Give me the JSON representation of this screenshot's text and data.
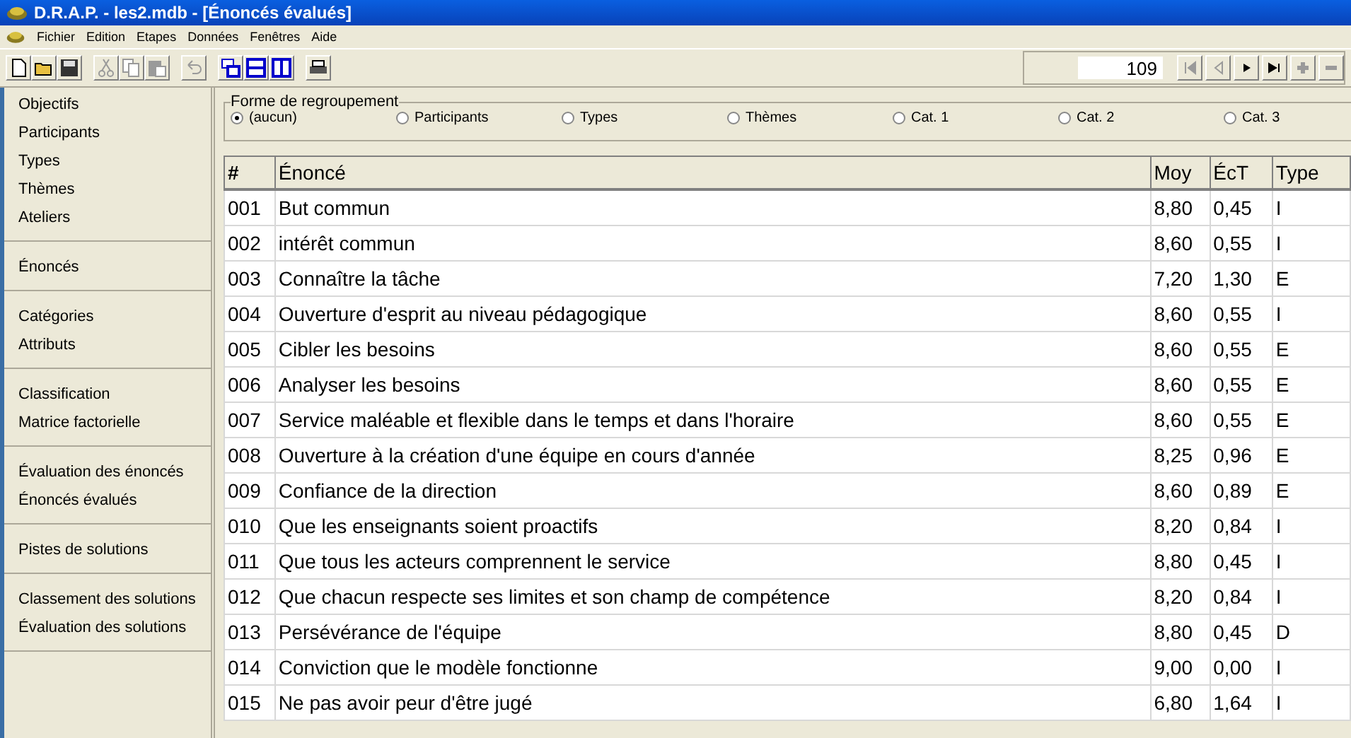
{
  "window": {
    "title": "D.R.A.P. - les2.mdb - [Énoncés évalués]"
  },
  "menu": [
    "Fichier",
    "Edition",
    "Etapes",
    "Données",
    "Fenêtres",
    "Aide"
  ],
  "toolbar": [
    {
      "kind": "new",
      "disabled": false
    },
    {
      "kind": "open",
      "disabled": false
    },
    {
      "kind": "save",
      "disabled": false
    },
    {
      "kind": "sep"
    },
    {
      "kind": "cut",
      "disabled": true
    },
    {
      "kind": "copy",
      "disabled": true
    },
    {
      "kind": "paste",
      "disabled": true
    },
    {
      "kind": "sep"
    },
    {
      "kind": "undo",
      "disabled": true
    },
    {
      "kind": "sep"
    },
    {
      "kind": "cascade",
      "disabled": false
    },
    {
      "kind": "tile-h",
      "disabled": false
    },
    {
      "kind": "tile-v",
      "disabled": false
    },
    {
      "kind": "sep"
    },
    {
      "kind": "print",
      "disabled": false
    }
  ],
  "navigator": {
    "record": "109",
    "buttons": [
      {
        "kind": "first",
        "disabled": true
      },
      {
        "kind": "prev",
        "disabled": true
      },
      {
        "kind": "next",
        "disabled": false
      },
      {
        "kind": "last",
        "disabled": false
      },
      {
        "kind": "add",
        "disabled": true
      },
      {
        "kind": "delete",
        "disabled": true
      }
    ]
  },
  "sidebar": [
    [
      "Objectifs",
      "Participants",
      "Types",
      "Thèmes",
      "Ateliers"
    ],
    [
      "Énoncés"
    ],
    [
      "Catégories",
      "Attributs"
    ],
    [
      "Classification",
      "Matrice factorielle"
    ],
    [
      "Évaluation des énoncés",
      "Énoncés évalués"
    ],
    [
      "Pistes de solutions"
    ],
    [
      "Classement des solutions",
      "Évaluation des solutions"
    ]
  ],
  "grouping": {
    "title": "Forme de regroupement",
    "options": [
      {
        "label": "(aucun)",
        "selected": true
      },
      {
        "label": "Participants",
        "selected": false
      },
      {
        "label": "Types",
        "selected": false
      },
      {
        "label": "Thèmes",
        "selected": false
      },
      {
        "label": "Cat. 1",
        "selected": false
      },
      {
        "label": "Cat. 2",
        "selected": false
      },
      {
        "label": "Cat. 3",
        "selected": false
      }
    ]
  },
  "table": {
    "columns": [
      "#",
      "Énoncé",
      "Moy",
      "ÉcT",
      "Type"
    ],
    "rows": [
      [
        "001",
        "But commun",
        "8,80",
        "0,45",
        "I"
      ],
      [
        "002",
        "intérêt commun",
        "8,60",
        "0,55",
        "I"
      ],
      [
        "003",
        "Connaître la tâche",
        "7,20",
        "1,30",
        "E"
      ],
      [
        "004",
        "Ouverture d'esprit au niveau pédagogique",
        "8,60",
        "0,55",
        "I"
      ],
      [
        "005",
        "Cibler les besoins",
        "8,60",
        "0,55",
        "E"
      ],
      [
        "006",
        "Analyser les besoins",
        "8,60",
        "0,55",
        "E"
      ],
      [
        "007",
        "Service maléable et flexible dans le temps et dans l'horaire",
        "8,60",
        "0,55",
        "E"
      ],
      [
        "008",
        "Ouverture à la création d'une équipe en cours d'année",
        "8,25",
        "0,96",
        "E"
      ],
      [
        "009",
        "Confiance de la direction",
        "8,60",
        "0,89",
        "E"
      ],
      [
        "010",
        "Que les enseignants soient proactifs",
        "8,20",
        "0,84",
        "I"
      ],
      [
        "011",
        "Que tous les acteurs comprennent le service",
        "8,80",
        "0,45",
        "I"
      ],
      [
        "012",
        "Que chacun respecte ses limites et son champ de compétence",
        "8,20",
        "0,84",
        "I"
      ],
      [
        "013",
        "Persévérance de l'équipe",
        "8,80",
        "0,45",
        "D"
      ],
      [
        "014",
        "Conviction que le modèle fonctionne",
        "9,00",
        "0,00",
        "I"
      ],
      [
        "015",
        "Ne pas avoir peur d'être jugé",
        "6,80",
        "1,64",
        "I"
      ]
    ]
  }
}
